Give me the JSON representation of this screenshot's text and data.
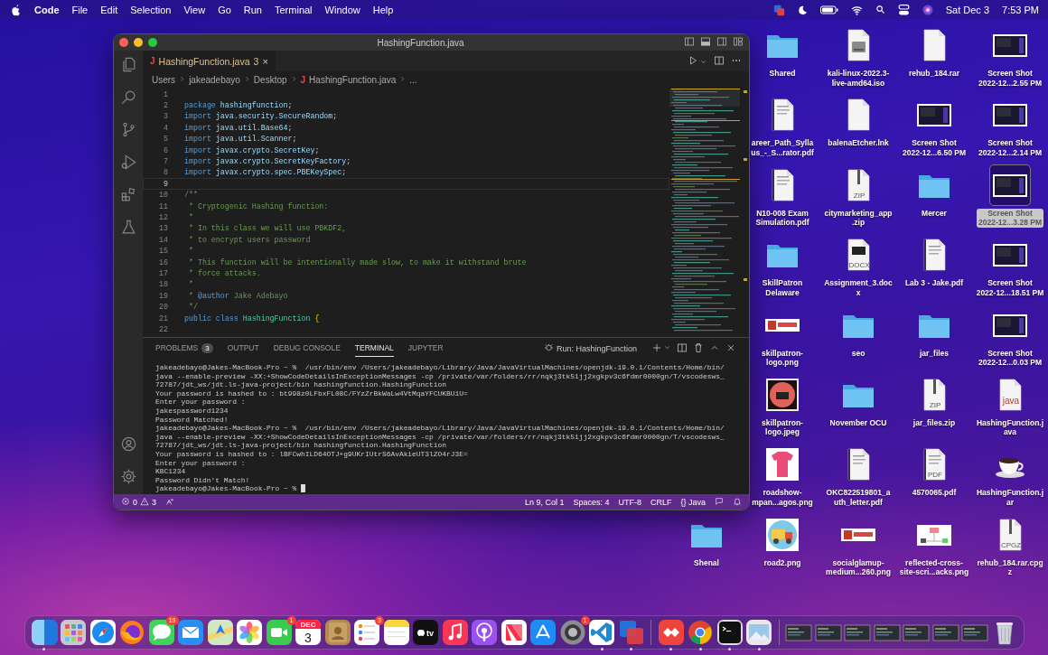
{
  "menu_bar": {
    "app": "Code",
    "items": [
      "File",
      "Edit",
      "Selection",
      "View",
      "Go",
      "Run",
      "Terminal",
      "Window",
      "Help"
    ],
    "date": "Sat Dec 3",
    "time": "7:53 PM"
  },
  "window": {
    "title": "HashingFunction.java",
    "tab": {
      "icon": "J",
      "label": "HashingFunction.java",
      "badge": "3",
      "close": "×"
    },
    "breadcrumb": [
      {
        "text": "Users"
      },
      {
        "text": "jakeadebayo"
      },
      {
        "text": "Desktop"
      },
      {
        "text": "HashingFunction.java",
        "icon": "J"
      },
      {
        "text": "..."
      }
    ],
    "code_lines": [
      {
        "number": "1",
        "current": false
      },
      {
        "number": "2",
        "current": false,
        "tokens": [
          {
            "kind": "keyword",
            "text": "package "
          },
          {
            "kind": "name",
            "text": "hashingfunction"
          },
          {
            "kind": "plain",
            "text": ";"
          }
        ]
      },
      {
        "number": "3",
        "current": false,
        "tokens": [
          {
            "kind": "keyword",
            "text": "import "
          },
          {
            "kind": "name",
            "text": "java.security.SecureRandom"
          },
          {
            "kind": "plain",
            "text": ";"
          }
        ]
      },
      {
        "number": "4",
        "current": false,
        "tokens": [
          {
            "kind": "keyword",
            "text": "import "
          },
          {
            "kind": "name",
            "text": "java.util.Base64"
          },
          {
            "kind": "plain",
            "text": ";"
          }
        ]
      },
      {
        "number": "5",
        "current": false,
        "tokens": [
          {
            "kind": "keyword",
            "text": "import "
          },
          {
            "kind": "name",
            "text": "java.util.Scanner"
          },
          {
            "kind": "plain",
            "text": ";"
          }
        ]
      },
      {
        "number": "6",
        "current": false,
        "tokens": [
          {
            "kind": "keyword",
            "text": "import "
          },
          {
            "kind": "name",
            "text": "javax.crypto.SecretKey"
          },
          {
            "kind": "plain",
            "text": ";"
          }
        ]
      },
      {
        "number": "7",
        "current": false,
        "tokens": [
          {
            "kind": "keyword",
            "text": "import "
          },
          {
            "kind": "name",
            "text": "javax.crypto.SecretKeyFactory"
          },
          {
            "kind": "plain",
            "text": ";"
          }
        ]
      },
      {
        "number": "8",
        "current": false,
        "tokens": [
          {
            "kind": "keyword",
            "text": "import "
          },
          {
            "kind": "name",
            "text": "javax.crypto.spec.PBEKeySpec"
          },
          {
            "kind": "plain",
            "text": ";"
          }
        ]
      },
      {
        "number": "9",
        "current": true
      },
      {
        "number": "10",
        "current": false,
        "tokens": [
          {
            "kind": "comment",
            "text": "/**"
          }
        ]
      },
      {
        "number": "11",
        "current": false,
        "tokens": [
          {
            "kind": "comment",
            "text": " * Cryptogenic Hashing function:"
          }
        ]
      },
      {
        "number": "12",
        "current": false,
        "tokens": [
          {
            "kind": "comment",
            "text": " *"
          }
        ]
      },
      {
        "number": "13",
        "current": false,
        "tokens": [
          {
            "kind": "comment",
            "text": " * In this class we will use PBKDF2,"
          }
        ]
      },
      {
        "number": "14",
        "current": false,
        "tokens": [
          {
            "kind": "comment",
            "text": " * to encrypt users password"
          }
        ]
      },
      {
        "number": "15",
        "current": false,
        "tokens": [
          {
            "kind": "comment",
            "text": " *"
          }
        ]
      },
      {
        "number": "16",
        "current": false,
        "tokens": [
          {
            "kind": "comment",
            "text": " * This function will be intentionally made slow, to make it withstand brute"
          }
        ]
      },
      {
        "number": "17",
        "current": false,
        "tokens": [
          {
            "kind": "comment",
            "text": " * force attacks."
          }
        ]
      },
      {
        "number": "18",
        "current": false,
        "tokens": [
          {
            "kind": "comment",
            "text": " *"
          }
        ]
      },
      {
        "number": "19",
        "current": false,
        "tokens": [
          {
            "kind": "comment",
            "text": " * "
          },
          {
            "kind": "tag",
            "text": "@author"
          },
          {
            "kind": "comment",
            "text": " Jake Adebayo"
          }
        ]
      },
      {
        "number": "20",
        "current": false,
        "tokens": [
          {
            "kind": "comment",
            "text": " */"
          }
        ]
      },
      {
        "number": "21",
        "current": false,
        "tokens": [
          {
            "kind": "keyword",
            "text": "public class "
          },
          {
            "kind": "type",
            "text": "HashingFunction "
          },
          {
            "kind": "brace",
            "text": "{"
          }
        ]
      },
      {
        "number": "22",
        "current": false
      }
    ],
    "panel_tabs": [
      {
        "label": "PROBLEMS",
        "badge": "3",
        "selected": false
      },
      {
        "label": "OUTPUT",
        "selected": false
      },
      {
        "label": "DEBUG CONSOLE",
        "selected": false
      },
      {
        "label": "TERMINAL",
        "selected": true
      },
      {
        "label": "JUPYTER",
        "selected": false
      }
    ],
    "terminal_name": "Run: HashingFunction",
    "terminal_lines": [
      "jakeadebayo@Jakes-MacBook-Pro ~ %  /usr/bin/env /Users/jakeadebayo/Library/Java/JavaVirtualMachines/openjdk-19.0.1/Contents/Home/bin/",
      "java --enable-preview -XX:+ShowCodeDetailsInExceptionMessages -cp /private/var/folders/rr/nqkj3tk51jj2xgkpv3c6fdmr0000gn/T/vscodesws_",
      "72787/jdt_ws/jdt.ls-java-project/bin hashingfunction.HashingFunction",
      "Your password is hashed to : bt998z0LFbxFL08C/FYzZrBkWaLw4VtMqaYFCUKBU1U=",
      "Enter your password :",
      "jakespassword1234",
      "Password Matched!",
      "jakeadebayo@Jakes-MacBook-Pro ~ %  /usr/bin/env /Users/jakeadebayo/Library/Java/JavaVirtualMachines/openjdk-19.0.1/Contents/Home/bin/",
      "java --enable-preview -XX:+ShowCodeDetailsInExceptionMessages -cp /private/var/folders/rr/nqkj3tk51jj2xgkpv3c6fdmr0000gn/T/vscodesws_",
      "72787/jdt_ws/jdt.ls-java-project/bin hashingfunction.HashingFunction",
      "Your password is hashed to : lBFCwhILD64OTJ+g9UKrIUtrS6AvAkieUT3lZO4rJ3E=",
      "Enter your password :",
      "KBC1234",
      "Password Didn't Match!",
      "jakeadebayo@Jakes-MacBook-Pro ~ % "
    ],
    "status_bar": {
      "errors": "0",
      "warnings": "3",
      "cursor_position": "Ln 9, Col 1",
      "indent": "Spaces: 4",
      "encoding": "UTF-8",
      "line_ending": "CRLF",
      "language_icon": "{}",
      "language": "Java"
    }
  },
  "desktop_rows": [
    [
      {
        "kind": "folder",
        "label": "Shared",
        "selected": false
      },
      {
        "kind": "iso",
        "label": "kali-linux-2022.3-\nlive-amd64.iso",
        "selected": false
      },
      {
        "kind": "file",
        "label": "rehub_184.rar",
        "selected": false
      },
      {
        "kind": "screenshot",
        "label": "Screen Shot\n2022-12...2.55 PM",
        "selected": false
      }
    ],
    [
      {
        "kind": "pdf",
        "label": "areer_Path_Sylla\nus_-_S...rator.pdf",
        "selected": false
      },
      {
        "kind": "file",
        "label": "balenaEtcher.lnk",
        "selected": false
      },
      {
        "kind": "screenshot",
        "label": "Screen Shot\n2022-12...6.50 PM",
        "selected": false
      },
      {
        "kind": "screenshot",
        "label": "Screen Shot\n2022-12...2.14 PM",
        "selected": false
      }
    ],
    [
      {
        "kind": "pdf",
        "label": "N10-008 Exam\nSimulation.pdf",
        "selected": false
      },
      {
        "kind": "zip",
        "tag": "ZIP",
        "label": "citymarketing_app\n.zip",
        "selected": false
      },
      {
        "kind": "folder",
        "label": "Mercer",
        "selected": false
      },
      {
        "kind": "screenshot",
        "label": "Screen Shot\n2022-12...3.28 PM",
        "selected": true
      }
    ],
    [
      {
        "kind": "folder",
        "label": "SkillPatron\nDelaware",
        "selected": false
      },
      {
        "kind": "docx",
        "tag": "DOCX",
        "label": "Assignment_3.doc\nx",
        "selected": false
      },
      {
        "kind": "pdf",
        "label": "Lab 3 - Jake.pdf",
        "selected": false
      },
      {
        "kind": "screenshot",
        "label": "Screen Shot\n2022-12...18.51 PM",
        "selected": false
      }
    ],
    [
      {
        "kind": "banner",
        "label": "skillpatron-\nlogo.png",
        "selected": false
      },
      {
        "kind": "folder",
        "label": "seo",
        "selected": false
      },
      {
        "kind": "folder",
        "label": "jar_files",
        "selected": false
      },
      {
        "kind": "screenshot",
        "label": "Screen Shot\n2022-12...0.03 PM",
        "selected": false
      }
    ],
    [
      {
        "kind": "roundlogo",
        "label": "skillpatron-\nlogo.jpeg",
        "selected": false
      },
      {
        "kind": "folder",
        "label": "November OCU",
        "selected": false
      },
      {
        "kind": "zip",
        "tag": "ZIP",
        "label": "jar_files.zip",
        "selected": false
      },
      {
        "kind": "java",
        "tag": "java",
        "label": "HashingFunction.j\nava",
        "selected": false
      }
    ],
    [
      {
        "kind": "tshirt",
        "label": "roadshow-\nmpan...agos.png",
        "selected": false
      },
      {
        "kind": "pdf",
        "label": "OKC822519801_a\nuth_letter.pdf",
        "selected": false
      },
      {
        "kind": "pdf",
        "tag": "PDF",
        "label": "4570065.pdf",
        "selected": false
      },
      {
        "kind": "coffee",
        "label": "HashingFunction.j\nar",
        "selected": false
      }
    ],
    [
      {
        "kind": "folder",
        "label": "Shenal",
        "selected": false
      },
      {
        "kind": "truck",
        "label": "road2.png",
        "selected": false
      },
      {
        "kind": "banner",
        "label": "socialglamup-\nmedium...260.png",
        "selected": false
      },
      {
        "kind": "diagram",
        "label": "reflected-cross-\nsite-scri...acks.png",
        "selected": false
      },
      {
        "kind": "zip",
        "tag": "CPGZ",
        "label": "rehub_184.rar.cpg\nz",
        "selected": false
      }
    ]
  ],
  "dock": [
    {
      "kind": "finder",
      "running": true
    },
    {
      "kind": "launchpad",
      "running": false
    },
    {
      "kind": "safari",
      "running": false
    },
    {
      "kind": "firefox",
      "running": false
    },
    {
      "kind": "messages",
      "badge": "19",
      "running": false
    },
    {
      "kind": "mail",
      "running": false
    },
    {
      "kind": "maps",
      "running": false
    },
    {
      "kind": "photos",
      "running": false
    },
    {
      "kind": "facetime",
      "badge": "1",
      "running": false
    },
    {
      "kind": "calendar",
      "month": "DEC",
      "day": "3",
      "running": false
    },
    {
      "kind": "contacts",
      "running": false
    },
    {
      "kind": "reminders",
      "badge": "3",
      "running": false
    },
    {
      "kind": "notes",
      "running": false
    },
    {
      "kind": "tv",
      "label": "tv",
      "running": false
    },
    {
      "kind": "music",
      "running": false
    },
    {
      "kind": "podcasts",
      "running": false
    },
    {
      "kind": "news",
      "running": false
    },
    {
      "kind": "appstore",
      "running": false
    },
    {
      "kind": "settings",
      "badge": "1",
      "running": false
    },
    {
      "kind": "vscode",
      "running": true
    },
    {
      "kind": "parallels",
      "running": true
    },
    {
      "kind": "divider"
    },
    {
      "kind": "anydesk",
      "running": true
    },
    {
      "kind": "chrome",
      "running": true
    },
    {
      "kind": "terminal",
      "running": true
    },
    {
      "kind": "preview",
      "running": true
    },
    {
      "kind": "divider"
    },
    {
      "kind": "window",
      "running": false
    },
    {
      "kind": "window",
      "running": false
    },
    {
      "kind": "window",
      "running": false
    },
    {
      "kind": "window",
      "running": false
    },
    {
      "kind": "window",
      "running": false
    },
    {
      "kind": "window",
      "running": false
    },
    {
      "kind": "window",
      "running": false
    },
    {
      "kind": "trash",
      "running": false
    }
  ]
}
